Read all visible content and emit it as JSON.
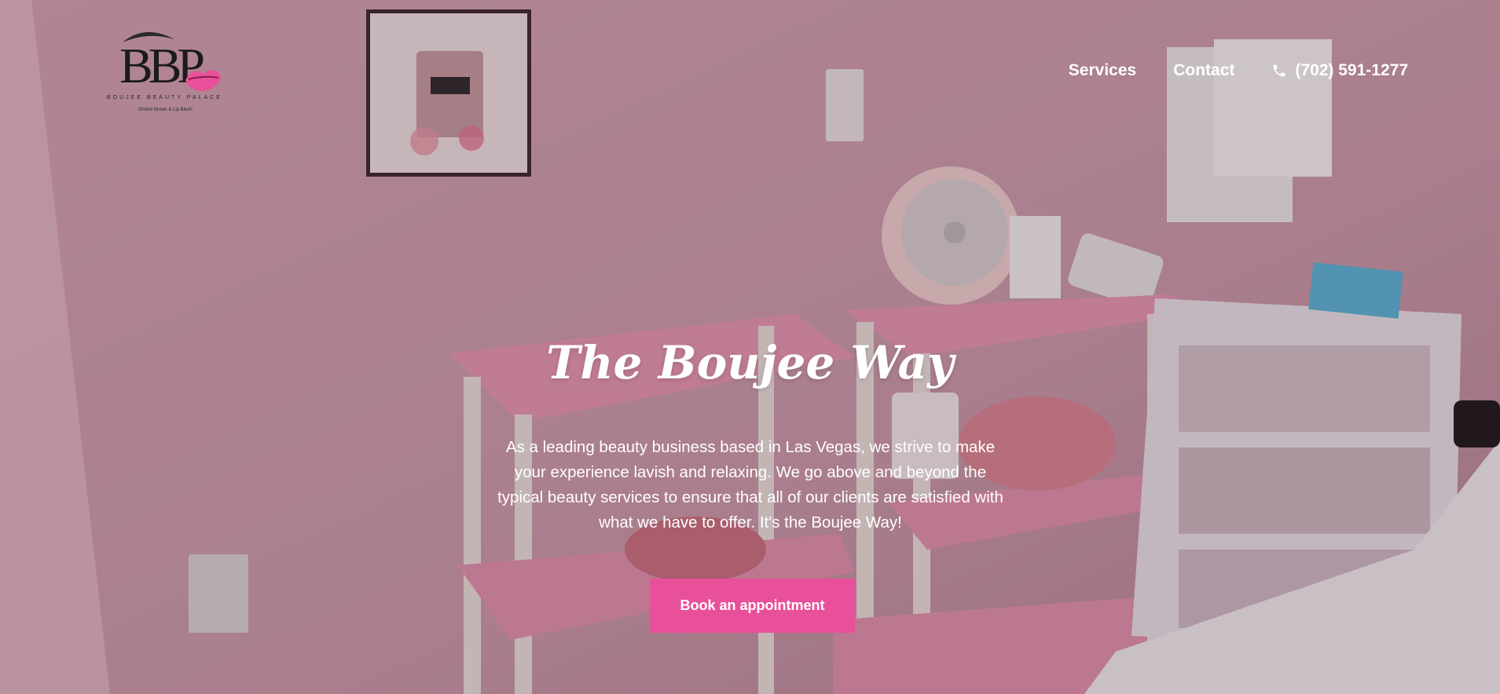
{
  "brand": {
    "logo_mark": "BBP",
    "name": "BOUJEE BEAUTY PALACE",
    "tagline": "Ombré Brows & Lip Blush",
    "accent_color": "#e8509a"
  },
  "nav": {
    "items": [
      {
        "label": "Services"
      },
      {
        "label": "Contact"
      }
    ],
    "phone": {
      "label": "(702) 591-1277",
      "icon": "phone-icon"
    }
  },
  "hero": {
    "title": "The Boujee Way",
    "description": "As a leading beauty business based in Las Vegas, we strive to make your experience lavish and relaxing. We go above and beyond the typical beauty services to ensure that all of our clients are satisfied with what we have to offer. It's the Boujee Way!",
    "cta_label": "Book an appointment"
  }
}
